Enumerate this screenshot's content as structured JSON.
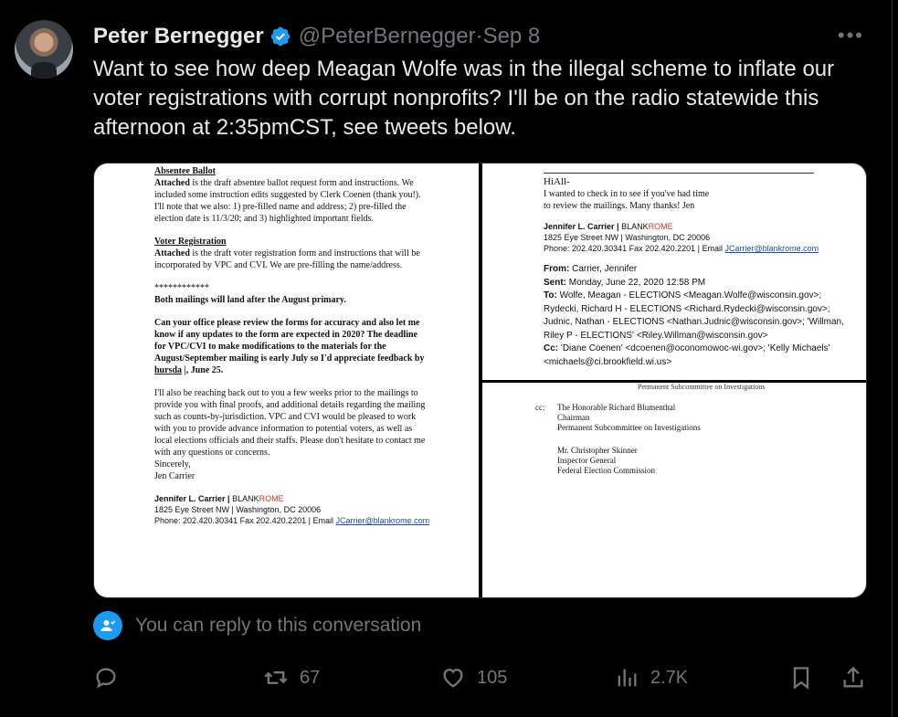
{
  "author": {
    "name": "Peter Bernegger",
    "handle": "@PeterBernegger",
    "date": "Sep 8",
    "separator": " · "
  },
  "tweet": {
    "text": "Want to see how deep Meagan Wolfe was in the illegal scheme to inflate our voter registrations with corrupt nonprofits?  I'll be on the radio statewide this afternoon at 2:35pmCST, see tweets below."
  },
  "menu": {
    "more": "•••"
  },
  "doc_left": {
    "h1": "Absentee Ballot",
    "p1_bold": "Attached",
    "p1": " is the draft absentee ballot request form and instructions. We included some instruction edits suggested by Clerk Coenen (thank you!). I'll note that we also: 1) pre-filled name and address; 2) pre-filled the election date is 11/3/20; and 3) highlighted important fields.",
    "h2": "Voter Registration",
    "p2_bold": "Attached",
    "p2": " is the draft voter registration form and instructions that will be incorporated by VPC and CVI.  We are pre-filling the name/address.",
    "stars": "************",
    "p3": "Both mailings will land after the August primary.",
    "p4a": "Can your office please review the forms for accuracy and also let me know if any updates to the form are expected in 2020?  The deadline for VPC/CVI to make modifications to the materials for the August/September mailing is early July so I'd appreciate feedback by ",
    "p4u": "hursda",
    "p4b": " |,  June 25.",
    "p5": "I'll also be reaching back out to you a few weeks prior to the mailings to provide you with final proofs, and additional details regarding the mailing such as counts-by-jurisdiction.  VPC and CVI would be pleased to work with you to provide advance information to potential voters, as well as local elections officials and their staffs. Please don't hesitate to contact me with any questions or concerns.",
    "closing": "Sincerely,",
    "closing_name": "Jen Carrier",
    "sig_name": "Jennifer L. Carrier | ",
    "sig_firm_a": "BLANK",
    "sig_firm_b": "ROME",
    "sig_addr": "1825 Eye Street NW | Washington, DC 20006",
    "sig_phone": "Phone:  202.420.30341 Fax  202.420.2201 | Email ",
    "sig_email": "JCarrier@blankrome.com"
  },
  "doc_rt": {
    "greet": "HiAll-",
    "body": "I wanted to check in to see if you've had time to review the mailings.  Many thanks!   Jen",
    "sig_name": "Jennifer L. Carrier | ",
    "sig_firm_a": "BLANK",
    "sig_firm_b": "ROME",
    "sig_addr": "1825 Eye Street NW | Washington, DC 20006",
    "sig_phone": "Phone:  202.420.30341 Fax  202.420.2201 | Email ",
    "sig_email": "JCarrier@blankrome.com",
    "from_lbl": "From:",
    "from": " Carrier, Jennifer",
    "sent_lbl": "Sent:",
    "sent": " Monday, June 22, 2020 12:58 PM",
    "to_lbl": "To:",
    "to": " Wolfe, Meagan - ELECTIONS <Meagan.Wolfe@wisconsin.gov>; Rydecki, Richard H - ELECTIONS <Richard.Rydecki@wisconsin.gov>;  Judnic, Nathan - ELECTIONS <Nathan.Judnic@wisconsin.gov>; 'Willman, Riley P - ELECTIONS' <Riley.Willman@wisconsin.gov>",
    "cc_lbl": "Cc:",
    "cc": " 'Diane Coenen' <dcoenen@oconomowoc-wi.gov>; 'Kelly Michaels' <michaels@ci.brookfield.wi.us>"
  },
  "doc_rb": {
    "cut": "Permanent Subcommittee on Investigations",
    "cc_lbl": "cc:",
    "b1": [
      "The Honorable Richard Blumenthal",
      "Chairman",
      "Permanent Subcommittee on Investigations"
    ],
    "b2": [
      "Mr. Christopher Skinner",
      "Inspector General",
      "Federal Election Commission"
    ]
  },
  "reply": {
    "text": "You can reply to this conversation"
  },
  "actions": {
    "reply_count": "",
    "retweets": "67",
    "likes": "105",
    "views": "2.7K"
  },
  "colors": {
    "accent": "#1d9bf0",
    "muted": "#71767b",
    "text": "#e7e9ea"
  }
}
